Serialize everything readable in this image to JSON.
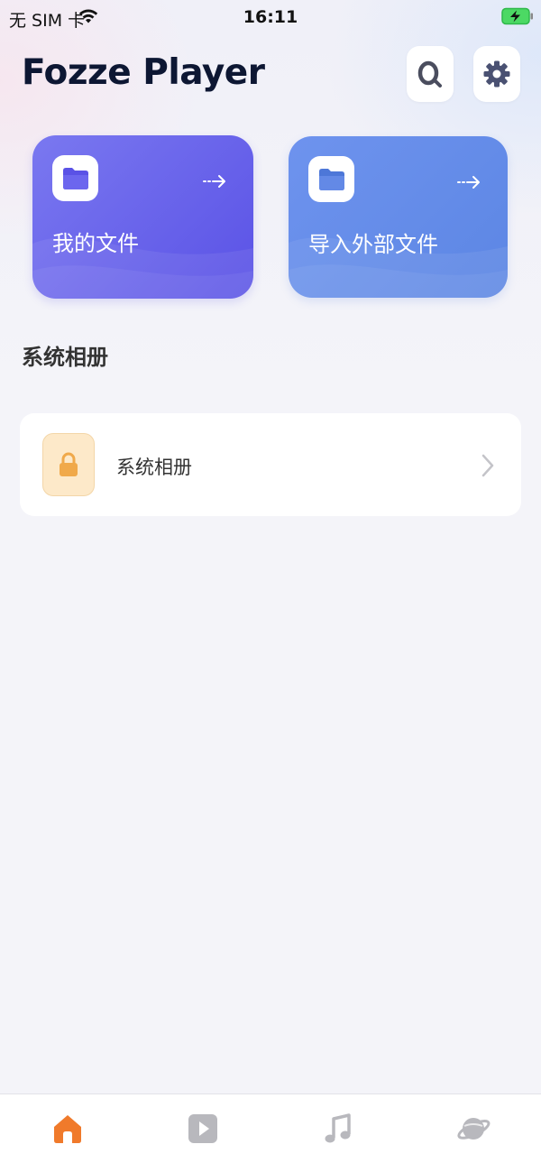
{
  "status_bar": {
    "carrier": "无 SIM 卡",
    "time": "16:11",
    "icons": [
      "wifi-icon",
      "battery-charging-icon"
    ]
  },
  "header": {
    "title": "Fozze Player",
    "buttons": [
      "search-icon",
      "gear-icon"
    ]
  },
  "cards": [
    {
      "label": "我的文件",
      "icon": "folder-icon",
      "color": "#5f57e8"
    },
    {
      "label": "导入外部文件",
      "icon": "folder-icon",
      "color": "#6389e6"
    }
  ],
  "section": {
    "title": "系统相册",
    "items": [
      {
        "label": "系统相册",
        "icon": "lock-icon",
        "accent": "#f0a94a"
      }
    ]
  },
  "tab_bar": {
    "tabs": [
      {
        "icon": "home-icon",
        "active": true
      },
      {
        "icon": "video-icon",
        "active": false
      },
      {
        "icon": "music-icon",
        "active": false
      },
      {
        "icon": "planet-icon",
        "active": false
      }
    ],
    "active_color": "#f07a2b",
    "inactive_color": "#b8b8bd"
  }
}
